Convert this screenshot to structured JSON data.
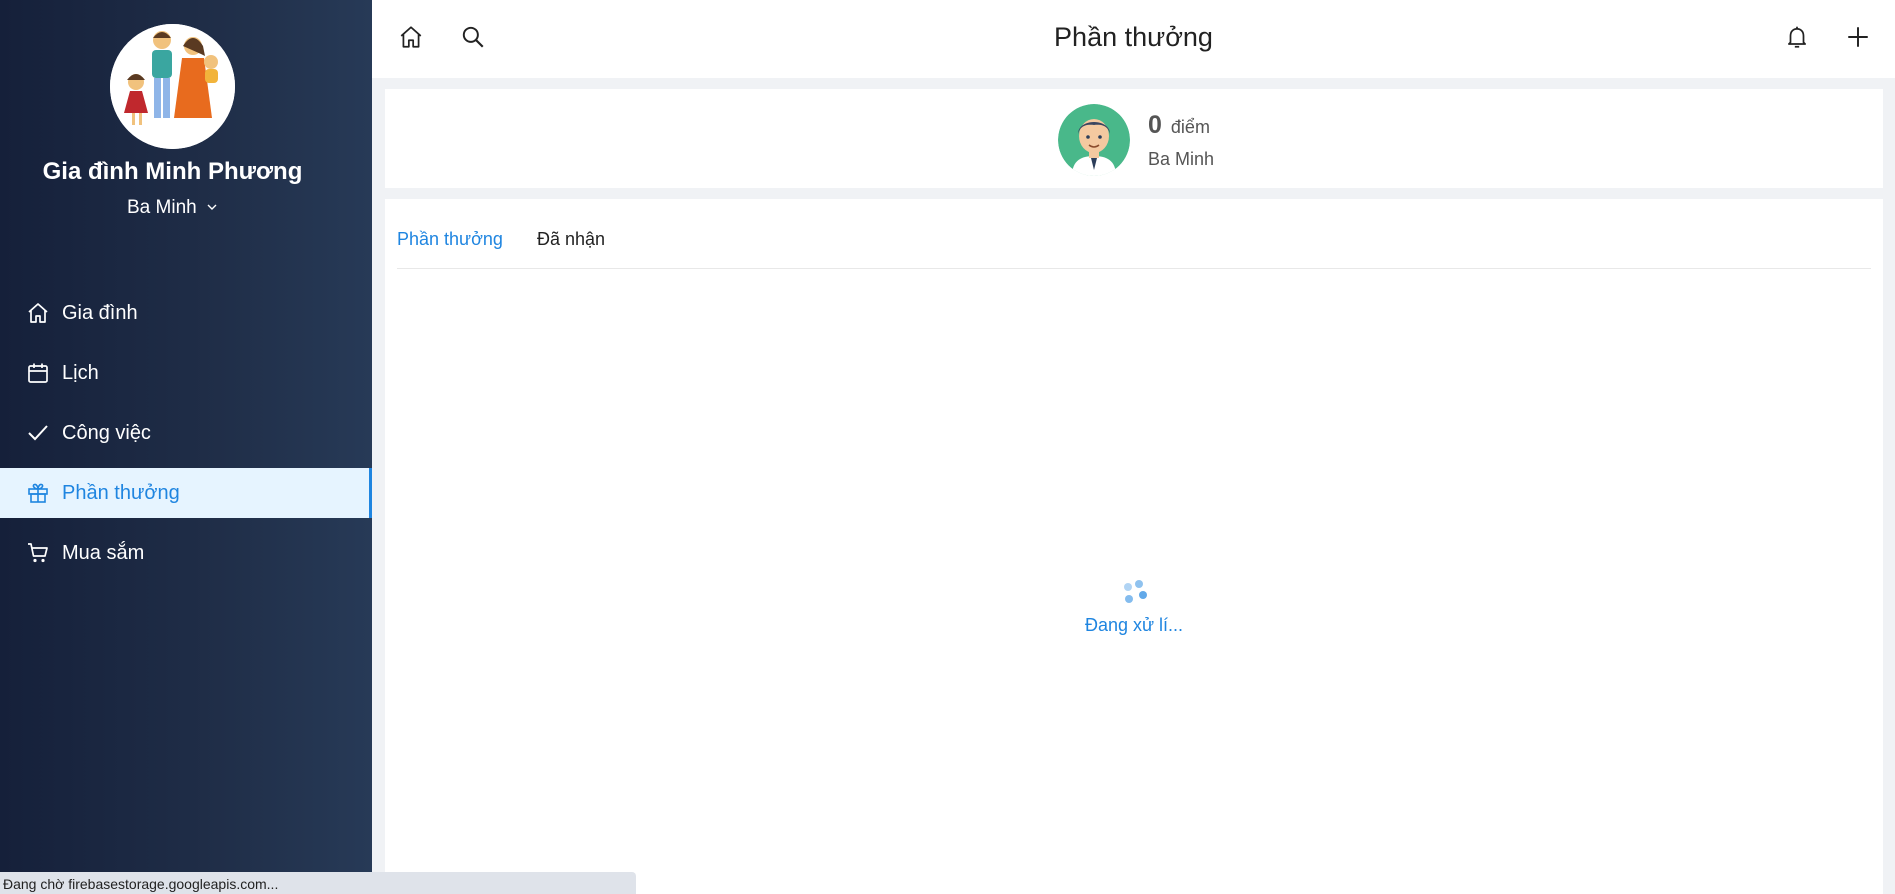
{
  "sidebar": {
    "family_name": "Gia đình Minh Phương",
    "member": "Ba Minh",
    "items": [
      {
        "label": "Gia đình",
        "icon": "home-icon"
      },
      {
        "label": "Lịch",
        "icon": "calendar-icon"
      },
      {
        "label": "Công việc",
        "icon": "check-icon"
      },
      {
        "label": "Phần thưởng",
        "icon": "gift-icon",
        "active": true
      },
      {
        "label": "Mua sắm",
        "icon": "cart-icon"
      }
    ]
  },
  "header": {
    "title": "Phần thưởng",
    "icons": [
      "home-icon",
      "search-icon",
      "bell-icon",
      "plus-icon"
    ]
  },
  "points": {
    "value": "0",
    "unit": "điểm",
    "user_name": "Ba Minh"
  },
  "tabs": [
    {
      "label": "Phần thưởng",
      "active": true
    },
    {
      "label": "Đã nhận",
      "active": false
    }
  ],
  "loading": {
    "text": "Đang xử lí..."
  },
  "status_bar": {
    "text": "Đang chờ firebasestorage.googleapis.com..."
  },
  "colors": {
    "accent": "#1f85e0",
    "sidebar_bg": "#1f2d47",
    "active_item_bg": "#e6f4ff"
  }
}
